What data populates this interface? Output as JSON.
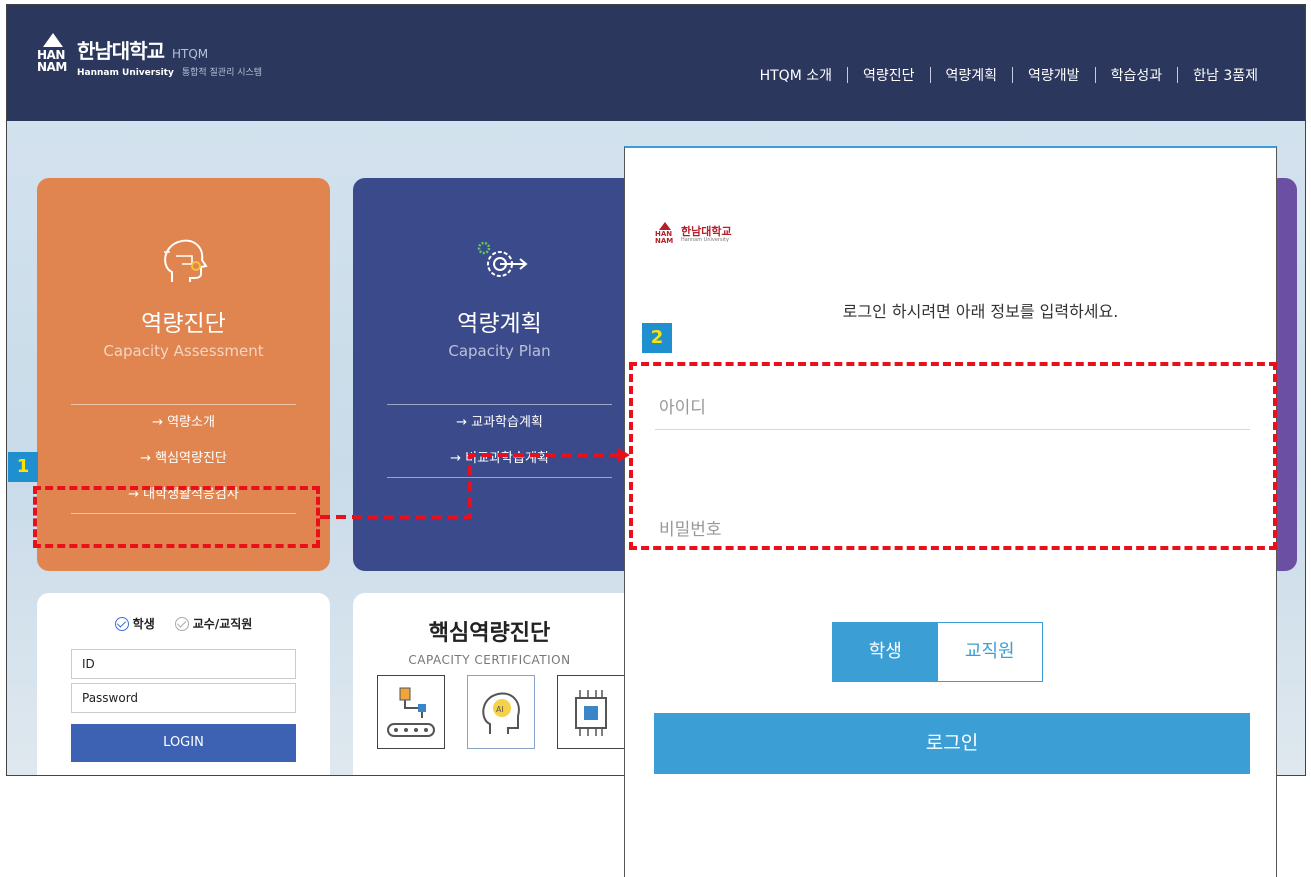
{
  "header": {
    "logo_mark_text": "HAN\nNAM",
    "logo_name": "한남대학교",
    "logo_htqm": "HTQM",
    "logo_english": "Hannam University",
    "logo_system": "통합적 질관리 시스템",
    "nav": [
      "HTQM 소개",
      "역량진단",
      "역량계획",
      "역량개발",
      "학습성과",
      "한남 3품제"
    ]
  },
  "cards": {
    "assessment": {
      "title": "역량진단",
      "subtitle": "Capacity Assessment",
      "links": [
        "→ 역량소개",
        "→ 핵심역량진단",
        "→ 대학생활적응검사"
      ],
      "icon": "head-gear-icon"
    },
    "plan": {
      "title": "역량계획",
      "subtitle": "Capacity Plan",
      "links": [
        "→ 교과학습계획",
        "→ 비교과학습계획"
      ],
      "icon": "gear-target-icon"
    }
  },
  "login_box": {
    "radio_student": "학생",
    "radio_staff": "교수/교직원",
    "id_value": "ID",
    "password_value": "Password",
    "button": "LOGIN"
  },
  "core_box": {
    "title": "핵심역량진단",
    "subtitle": "CAPACITY CERTIFICATION"
  },
  "popup": {
    "logo_name": "한남대학교",
    "logo_english": "Hannam University",
    "message": "로그인 하시려면 아래 정보를 입력하세요.",
    "id_placeholder": "아이디",
    "password_placeholder": "비밀번호",
    "toggle": [
      "학생",
      "교직원"
    ],
    "login_button": "로그인"
  },
  "annotations": {
    "badge1": "1",
    "badge2": "2"
  },
  "colors": {
    "header_bg": "#2b375d",
    "card_orange": "#e0854f",
    "card_blue": "#3a4a8b",
    "popup_accent": "#3b9fd6",
    "annotation_red": "#e8101a",
    "badge_blue": "#1f8fd0",
    "badge_text": "#ffe300"
  }
}
